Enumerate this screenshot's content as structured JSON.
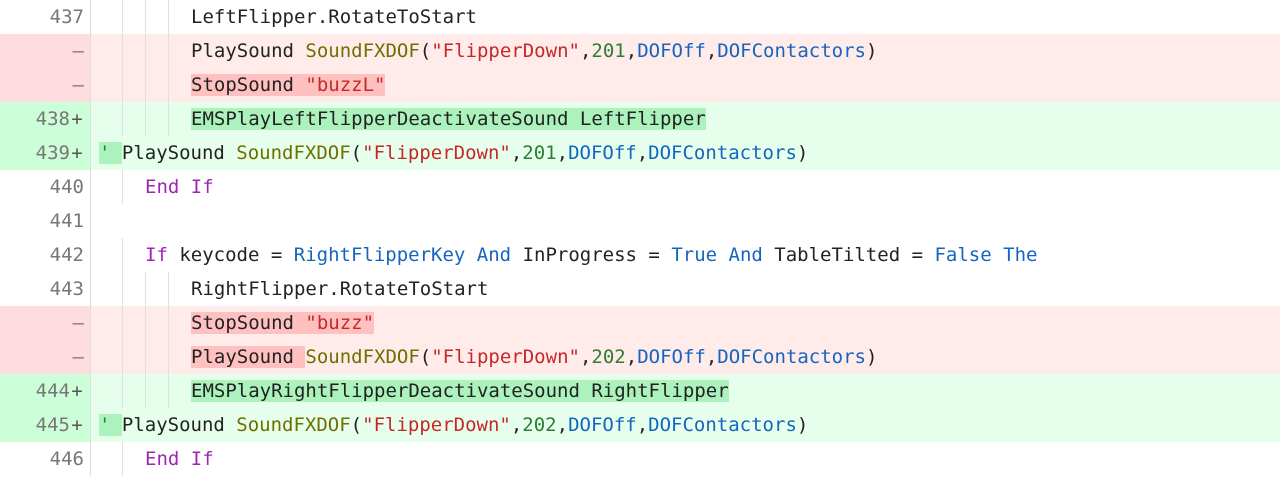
{
  "lines": [
    {
      "num": "437",
      "sign": "",
      "type": "normal",
      "indent": 8,
      "guides": [
        2,
        4,
        6
      ],
      "tokens": [
        {
          "t": "LeftFlipper.RotateToStart",
          "c": "plain",
          "hl": ""
        }
      ]
    },
    {
      "num": "—",
      "sign": "",
      "type": "removed",
      "indent": 8,
      "guides": [
        2,
        4,
        6
      ],
      "tokens": [
        {
          "t": "PlaySound ",
          "c": "plain",
          "hl": ""
        },
        {
          "t": "SoundFXDOF",
          "c": "func",
          "hl": ""
        },
        {
          "t": "(",
          "c": "plain",
          "hl": ""
        },
        {
          "t": "\"FlipperDown\"",
          "c": "str",
          "hl": ""
        },
        {
          "t": ",",
          "c": "plain",
          "hl": ""
        },
        {
          "t": "201",
          "c": "num",
          "hl": ""
        },
        {
          "t": ",",
          "c": "plain",
          "hl": ""
        },
        {
          "t": "DOFOff",
          "c": "ident",
          "hl": ""
        },
        {
          "t": ",",
          "c": "plain",
          "hl": ""
        },
        {
          "t": "DOFContactors",
          "c": "ident",
          "hl": ""
        },
        {
          "t": ")",
          "c": "plain",
          "hl": ""
        }
      ]
    },
    {
      "num": "—",
      "sign": "",
      "type": "removed",
      "indent": 8,
      "guides": [
        2,
        4,
        6
      ],
      "tokens": [
        {
          "t": "StopSound ",
          "c": "plain",
          "hl": "removed"
        },
        {
          "t": "\"buzzL\"",
          "c": "str",
          "hl": "removed"
        }
      ]
    },
    {
      "num": "438",
      "sign": "+",
      "type": "added",
      "indent": 8,
      "guides": [
        2,
        4,
        6
      ],
      "tokens": [
        {
          "t": "EMSPlayLeftFlipperDeactivateSound LeftFlipper",
          "c": "plain",
          "hl": "added"
        }
      ]
    },
    {
      "num": "439",
      "sign": "+",
      "type": "added",
      "indent": 0,
      "guides": [],
      "tokens": [
        {
          "t": "' ",
          "c": "comment-mark",
          "hl": "added"
        },
        {
          "t": "       ",
          "c": "plain",
          "hl": ""
        },
        {
          "t": "PlaySound ",
          "c": "plain",
          "hl": ""
        },
        {
          "t": "SoundFXDOF",
          "c": "func",
          "hl": ""
        },
        {
          "t": "(",
          "c": "plain",
          "hl": ""
        },
        {
          "t": "\"FlipperDown\"",
          "c": "str",
          "hl": ""
        },
        {
          "t": ",",
          "c": "plain",
          "hl": ""
        },
        {
          "t": "201",
          "c": "num",
          "hl": ""
        },
        {
          "t": ",",
          "c": "plain",
          "hl": ""
        },
        {
          "t": "DOFOff",
          "c": "ident",
          "hl": ""
        },
        {
          "t": ",",
          "c": "plain",
          "hl": ""
        },
        {
          "t": "DOFContactors",
          "c": "ident",
          "hl": ""
        },
        {
          "t": ")",
          "c": "plain",
          "hl": ""
        }
      ]
    },
    {
      "num": "440",
      "sign": "",
      "type": "normal",
      "indent": 4,
      "guides": [
        2
      ],
      "tokens": [
        {
          "t": "End",
          "c": "kw",
          "hl": ""
        },
        {
          "t": " ",
          "c": "plain",
          "hl": ""
        },
        {
          "t": "If",
          "c": "kw",
          "hl": ""
        }
      ]
    },
    {
      "num": "441",
      "sign": "",
      "type": "normal",
      "indent": 0,
      "guides": [],
      "tokens": []
    },
    {
      "num": "442",
      "sign": "",
      "type": "normal",
      "indent": 4,
      "guides": [
        2
      ],
      "tokens": [
        {
          "t": "If",
          "c": "kw",
          "hl": ""
        },
        {
          "t": " keycode ",
          "c": "plain",
          "hl": ""
        },
        {
          "t": "=",
          "c": "plain",
          "hl": ""
        },
        {
          "t": " ",
          "c": "plain",
          "hl": ""
        },
        {
          "t": "RightFlipperKey",
          "c": "ident",
          "hl": ""
        },
        {
          "t": " ",
          "c": "plain",
          "hl": ""
        },
        {
          "t": "And",
          "c": "kw2",
          "hl": ""
        },
        {
          "t": " InProgress ",
          "c": "plain",
          "hl": ""
        },
        {
          "t": "=",
          "c": "plain",
          "hl": ""
        },
        {
          "t": " ",
          "c": "plain",
          "hl": ""
        },
        {
          "t": "True",
          "c": "kw2",
          "hl": ""
        },
        {
          "t": " ",
          "c": "plain",
          "hl": ""
        },
        {
          "t": "And",
          "c": "kw2",
          "hl": ""
        },
        {
          "t": " TableTilted ",
          "c": "plain",
          "hl": ""
        },
        {
          "t": "=",
          "c": "plain",
          "hl": ""
        },
        {
          "t": " ",
          "c": "plain",
          "hl": ""
        },
        {
          "t": "False",
          "c": "kw2",
          "hl": ""
        },
        {
          "t": " ",
          "c": "plain",
          "hl": ""
        },
        {
          "t": "The",
          "c": "kw2",
          "hl": ""
        }
      ]
    },
    {
      "num": "443",
      "sign": "",
      "type": "normal",
      "indent": 8,
      "guides": [
        2,
        4,
        6
      ],
      "tokens": [
        {
          "t": "RightFlipper.RotateToStart",
          "c": "plain",
          "hl": ""
        }
      ]
    },
    {
      "num": "—",
      "sign": "",
      "type": "removed",
      "indent": 8,
      "guides": [
        2,
        4,
        6
      ],
      "tokens": [
        {
          "t": "StopSound ",
          "c": "plain",
          "hl": "removed"
        },
        {
          "t": "\"buzz\"",
          "c": "str",
          "hl": "removed"
        }
      ]
    },
    {
      "num": "—",
      "sign": "",
      "type": "removed",
      "indent": 8,
      "guides": [
        2,
        4,
        6
      ],
      "tokens": [
        {
          "t": "PlaySound ",
          "c": "plain",
          "hl": "removed"
        },
        {
          "t": "SoundFXDOF",
          "c": "func",
          "hl": ""
        },
        {
          "t": "(",
          "c": "plain",
          "hl": ""
        },
        {
          "t": "\"FlipperDown\"",
          "c": "str",
          "hl": ""
        },
        {
          "t": ",",
          "c": "plain",
          "hl": ""
        },
        {
          "t": "202",
          "c": "num",
          "hl": ""
        },
        {
          "t": ",",
          "c": "plain",
          "hl": ""
        },
        {
          "t": "DOFOff",
          "c": "ident",
          "hl": ""
        },
        {
          "t": ",",
          "c": "plain",
          "hl": ""
        },
        {
          "t": "DOFContactors",
          "c": "ident",
          "hl": ""
        },
        {
          "t": ")",
          "c": "plain",
          "hl": ""
        }
      ]
    },
    {
      "num": "444",
      "sign": "+",
      "type": "added",
      "indent": 8,
      "guides": [
        2,
        4,
        6
      ],
      "tokens": [
        {
          "t": "EMSPlayRightFlipperDeactivateSound RightFlipper",
          "c": "plain",
          "hl": "added"
        }
      ]
    },
    {
      "num": "445",
      "sign": "+",
      "type": "added",
      "indent": 0,
      "guides": [],
      "tokens": [
        {
          "t": "' ",
          "c": "comment-mark",
          "hl": "added"
        },
        {
          "t": "       ",
          "c": "plain",
          "hl": ""
        },
        {
          "t": "PlaySound ",
          "c": "plain",
          "hl": ""
        },
        {
          "t": "SoundFXDOF",
          "c": "func",
          "hl": ""
        },
        {
          "t": "(",
          "c": "plain",
          "hl": ""
        },
        {
          "t": "\"FlipperDown\"",
          "c": "str",
          "hl": ""
        },
        {
          "t": ",",
          "c": "plain",
          "hl": ""
        },
        {
          "t": "202",
          "c": "num",
          "hl": ""
        },
        {
          "t": ",",
          "c": "plain",
          "hl": ""
        },
        {
          "t": "DOFOff",
          "c": "ident",
          "hl": ""
        },
        {
          "t": ",",
          "c": "plain",
          "hl": ""
        },
        {
          "t": "DOFContactors",
          "c": "ident",
          "hl": ""
        },
        {
          "t": ")",
          "c": "plain",
          "hl": ""
        }
      ]
    },
    {
      "num": "446",
      "sign": "",
      "type": "normal",
      "indent": 4,
      "guides": [
        2
      ],
      "tokens": [
        {
          "t": "End",
          "c": "kw",
          "hl": ""
        },
        {
          "t": " ",
          "c": "plain",
          "hl": ""
        },
        {
          "t": "If",
          "c": "kw",
          "hl": ""
        }
      ]
    }
  ]
}
